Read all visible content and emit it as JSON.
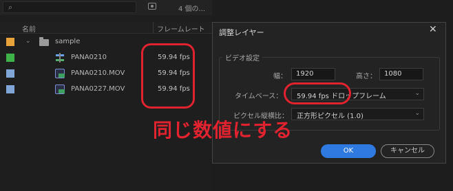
{
  "project_panel": {
    "search": {
      "placeholder": ""
    },
    "item_count": "4 個の...",
    "columns": {
      "name": "名前",
      "frame_rate": "フレームレート"
    },
    "rows": [
      {
        "label": "sample",
        "type": "folder",
        "color": "#e8a33a",
        "fps": ""
      },
      {
        "label": "PANA0210",
        "type": "sequence",
        "color": "#3fb24a",
        "fps": "59.94 fps"
      },
      {
        "label": "PANA0210.MOV",
        "type": "clip",
        "color": "#7fa6d6",
        "fps": "59.94 fps"
      },
      {
        "label": "PANA0227.MOV",
        "type": "clip",
        "color": "#7fa6d6",
        "fps": "59.94 fps"
      }
    ]
  },
  "dialog": {
    "title": "調整レイヤー",
    "close_icon": "close-icon",
    "group_title": "ビデオ設定",
    "width_label": "幅：",
    "width_value": "1920",
    "height_label": "高さ：",
    "height_value": "1080",
    "timebase_label": "タイムベース：",
    "timebase_value": "59.94 fps ドロップフレーム",
    "pixel_aspect_label": "ピクセル縦横比：",
    "pixel_aspect_value": "正方形ピクセル (1.0)",
    "ok_label": "OK",
    "cancel_label": "キャンセル"
  },
  "annotation": {
    "text": "同じ数値にする",
    "color": "#e0232f"
  }
}
